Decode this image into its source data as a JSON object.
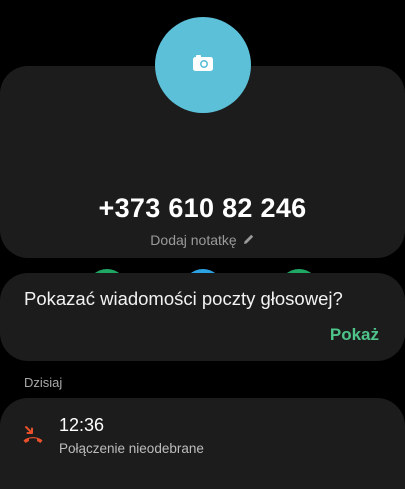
{
  "contact": {
    "phone_number": "+373 610 82 246",
    "add_note_label": "Dodaj notatkę"
  },
  "actions": [
    {
      "name": "call",
      "icon": "phone-icon",
      "color": "#1fa864"
    },
    {
      "name": "message",
      "icon": "message-icon",
      "color": "#2ba3e3"
    },
    {
      "name": "video",
      "icon": "video-icon",
      "color": "#1fa864"
    }
  ],
  "voicemail": {
    "question": "Pokazać wiadomości poczty głosowej?",
    "show_label": "Pokaż"
  },
  "call_log": {
    "section_header": "Dzisiaj",
    "entries": [
      {
        "time": "12:36",
        "status": "Połączenie nieodebrane",
        "icon": "missed-call-icon"
      }
    ]
  },
  "colors": {
    "avatar": "#5cc0d8",
    "accent_green": "#4ec38a",
    "missed_call": "#e8502b"
  }
}
